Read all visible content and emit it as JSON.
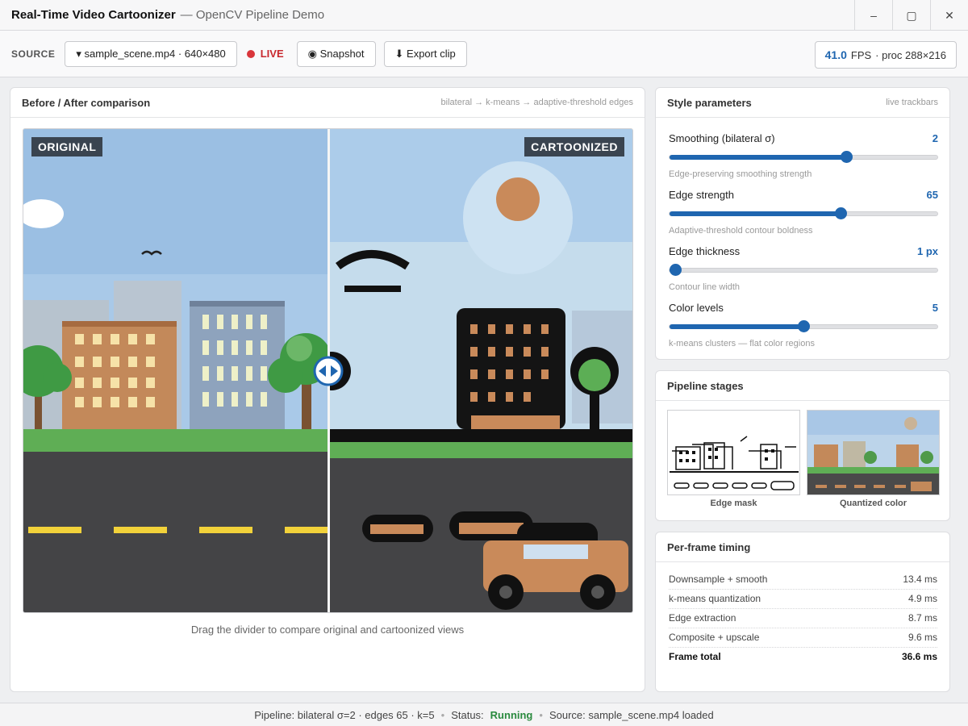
{
  "window": {
    "title_bold": "Real-Time Video Cartoonizer",
    "title_rest": "— OpenCV Pipeline Demo"
  },
  "toolbar": {
    "source_label": "SOURCE",
    "source_value": "▾ sample_scene.mp4 · 640×480",
    "live_label": "LIVE",
    "snapshot_label": "◉ Snapshot",
    "export_label": "⬇ Export clip",
    "fps_value": "41.0",
    "fps_unit": "FPS",
    "proc_text": "· proc 288×216"
  },
  "compare": {
    "title": "Before / After comparison",
    "pipeline": "bilateral → k-means → adaptive-threshold edges",
    "left_tag": "ORIGINAL",
    "right_tag": "CARTOONIZED",
    "hint": "Drag the divider to compare original and cartoonized views"
  },
  "params": {
    "title": "Style parameters",
    "subtitle": "live trackbars",
    "items": [
      {
        "label": "Smoothing (bilateral σ)",
        "value": "2",
        "fraction": 0.66,
        "help": "Edge-preserving smoothing strength"
      },
      {
        "label": "Edge strength",
        "value": "65",
        "fraction": 0.64,
        "help": "Adaptive-threshold contour boldness"
      },
      {
        "label": "Edge thickness",
        "value": "1 px",
        "fraction": 0.02,
        "help": "Contour line width"
      },
      {
        "label": "Color levels",
        "value": "5",
        "fraction": 0.5,
        "help": "k-means clusters — flat color regions"
      }
    ]
  },
  "stages": {
    "title": "Pipeline stages",
    "edge_caption": "Edge mask",
    "color_caption": "Quantized color"
  },
  "timing": {
    "title": "Per-frame timing",
    "rows": [
      {
        "label": "Downsample + smooth",
        "value": "13.4 ms"
      },
      {
        "label": "k-means quantization",
        "value": "4.9 ms"
      },
      {
        "label": "Edge extraction",
        "value": "8.7 ms"
      },
      {
        "label": "Composite + upscale",
        "value": "9.6 ms"
      }
    ],
    "total_label": "Frame total",
    "total_value": "36.6 ms"
  },
  "status": {
    "pipeline": "Pipeline: bilateral σ=2 · edges 65 · k=5",
    "status_label": "Status:",
    "status_value": "Running",
    "source": "Source: sample_scene.mp4 loaded"
  },
  "colors": {
    "accent": "#1f66b0",
    "live": "#d9363b",
    "running": "#2a8a3e"
  }
}
